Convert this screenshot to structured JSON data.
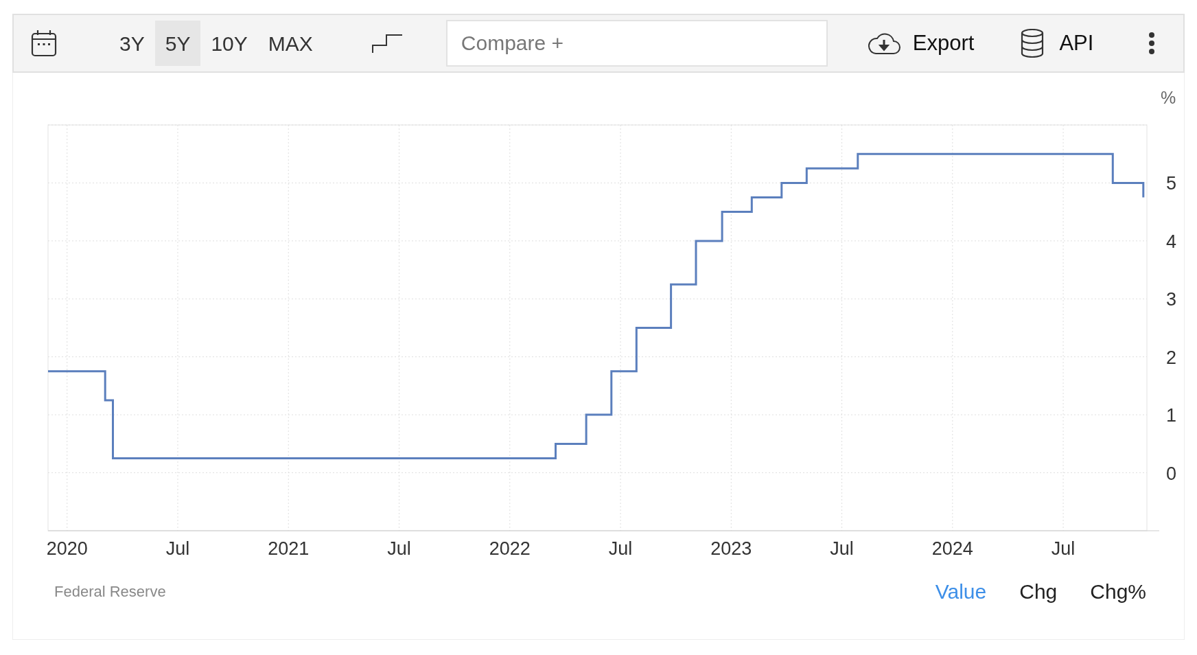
{
  "toolbar": {
    "ranges": [
      {
        "label": "3Y",
        "selected": false
      },
      {
        "label": "5Y",
        "selected": true
      },
      {
        "label": "10Y",
        "selected": false
      },
      {
        "label": "MAX",
        "selected": false
      }
    ],
    "compare": {
      "placeholder": "Compare +"
    },
    "export": {
      "label": "Export"
    },
    "api": {
      "label": "API"
    }
  },
  "chart": {
    "chart_data": {
      "type": "line",
      "grid": true,
      "ylabel": "%",
      "xlim": [
        2019.914,
        2024.878
      ],
      "ylim": [
        -1,
        6
      ],
      "xticks": [
        {
          "value": 2020,
          "label": "2020"
        },
        {
          "value": 2020.5,
          "label": "Jul"
        },
        {
          "value": 2021,
          "label": "2021"
        },
        {
          "value": 2021.5,
          "label": "Jul"
        },
        {
          "value": 2022,
          "label": "2022"
        },
        {
          "value": 2022.5,
          "label": "Jul"
        },
        {
          "value": 2023,
          "label": "2023"
        },
        {
          "value": 2023.5,
          "label": "Jul"
        },
        {
          "value": 2024,
          "label": "2024"
        },
        {
          "value": 2024.5,
          "label": "Jul"
        }
      ],
      "yticks": [
        0,
        1,
        2,
        3,
        4,
        5
      ],
      "x": [
        2019.914,
        2020.172,
        2020.172,
        2020.207,
        2020.207,
        2022.207,
        2022.207,
        2022.345,
        2022.345,
        2022.459,
        2022.459,
        2022.572,
        2022.572,
        2022.728,
        2022.728,
        2022.841,
        2022.841,
        2022.959,
        2022.959,
        2023.093,
        2023.093,
        2023.228,
        2023.228,
        2023.341,
        2023.341,
        2023.572,
        2023.572,
        2024.724,
        2024.724,
        2024.862,
        2024.862
      ],
      "series": [
        {
          "color": "#5b7fbd",
          "values": [
            1.75,
            1.75,
            1.25,
            1.25,
            0.25,
            0.25,
            0.5,
            0.5,
            1.0,
            1.0,
            1.75,
            1.75,
            2.5,
            2.5,
            3.25,
            3.25,
            4.0,
            4.0,
            4.5,
            4.5,
            4.75,
            4.75,
            5.0,
            5.0,
            5.25,
            5.25,
            5.5,
            5.5,
            5.0,
            5.0,
            4.75
          ]
        }
      ]
    }
  },
  "footer": {
    "source": "Federal Reserve",
    "modes": [
      {
        "label": "Value",
        "selected": true
      },
      {
        "label": "Chg",
        "selected": false
      },
      {
        "label": "Chg%",
        "selected": false
      }
    ]
  }
}
